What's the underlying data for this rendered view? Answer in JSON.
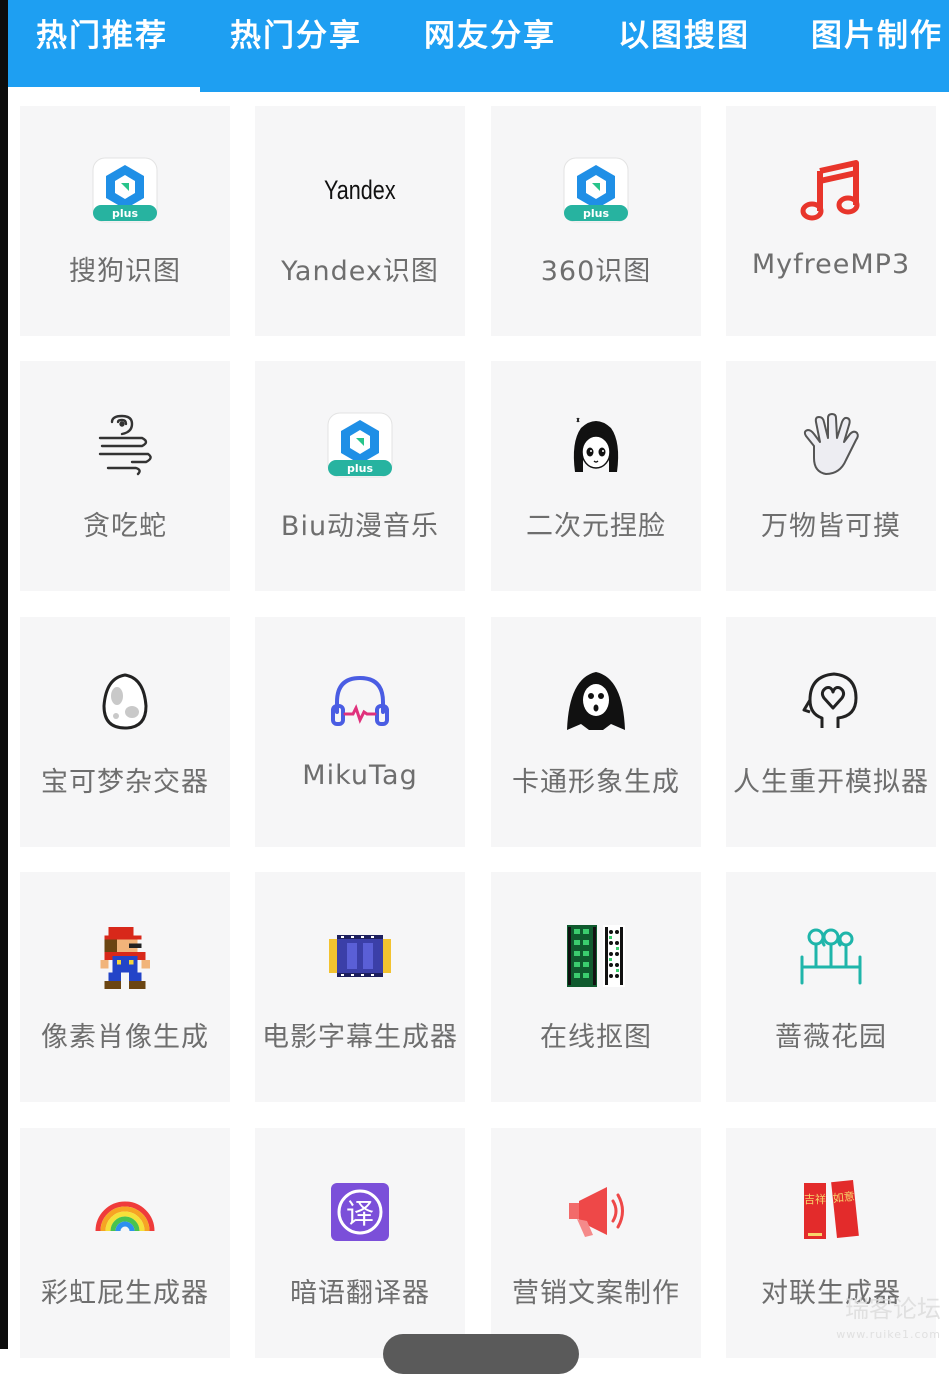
{
  "tabs": [
    {
      "label": "热门推荐",
      "active": true
    },
    {
      "label": "热门分享",
      "active": false
    },
    {
      "label": "网友分享",
      "active": false
    },
    {
      "label": "以图搜图",
      "active": false
    },
    {
      "label": "图片制作",
      "active": false
    }
  ],
  "colors": {
    "tabbar": "#1e9ff2",
    "card": "#f6f6f7",
    "label": "#6e6e6e"
  },
  "tools": [
    {
      "label": "搜狗识图",
      "icon": "plus-app-icon"
    },
    {
      "label": "Yandex识图",
      "icon": "yandex-logo-icon",
      "icon_text": "Yandex"
    },
    {
      "label": "360识图",
      "icon": "plus-app-icon"
    },
    {
      "label": "MyfreeMP3",
      "icon": "music-note-icon"
    },
    {
      "label": "贪吃蛇",
      "icon": "snake-icon"
    },
    {
      "label": "Biu动漫音乐",
      "icon": "plus-app-icon"
    },
    {
      "label": "二次元捏脸",
      "icon": "anime-girl-icon"
    },
    {
      "label": "万物皆可摸",
      "icon": "hand-icon"
    },
    {
      "label": "宝可梦杂交器",
      "icon": "egg-icon"
    },
    {
      "label": "MikuTag",
      "icon": "headphones-icon"
    },
    {
      "label": "卡通形象生成",
      "icon": "ghost-icon"
    },
    {
      "label": "人生重开模拟器",
      "icon": "head-heart-icon"
    },
    {
      "label": "像素肖像生成",
      "icon": "pixel-mario-icon"
    },
    {
      "label": "电影字幕生成器",
      "icon": "film-strip-icon"
    },
    {
      "label": "在线抠图",
      "icon": "film-cutout-icon"
    },
    {
      "label": "蔷薇花园",
      "icon": "garden-fence-icon"
    },
    {
      "label": "彩虹屁生成器",
      "icon": "rainbow-icon"
    },
    {
      "label": "暗语翻译器",
      "icon": "translate-icon",
      "icon_text": "译"
    },
    {
      "label": "营销文案制作",
      "icon": "megaphone-icon"
    },
    {
      "label": "对联生成器",
      "icon": "couplet-icon",
      "icon_text": [
        "吉祥",
        "如意"
      ]
    }
  ],
  "plus_badge": "plus",
  "watermark": {
    "line1": "瑞客论坛",
    "line2": "www.ruike1.com"
  }
}
